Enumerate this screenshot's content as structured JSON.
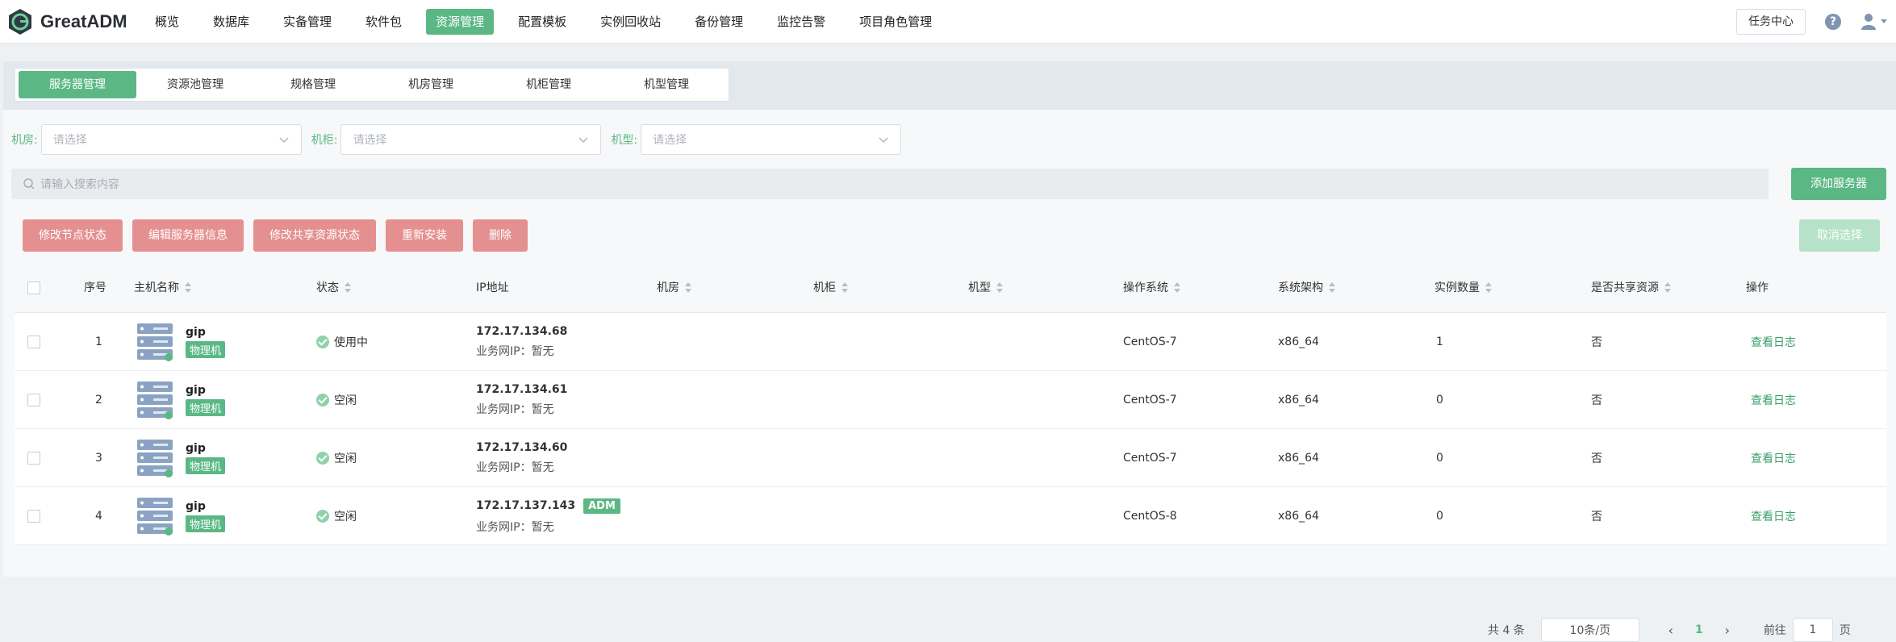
{
  "brand": {
    "name": "GreatADM"
  },
  "nav": {
    "items": [
      {
        "label": "概览"
      },
      {
        "label": "数据库"
      },
      {
        "label": "实备管理"
      },
      {
        "label": "软件包"
      },
      {
        "label": "资源管理",
        "active": true
      },
      {
        "label": "配置模板"
      },
      {
        "label": "实例回收站"
      },
      {
        "label": "备份管理"
      },
      {
        "label": "监控告警"
      },
      {
        "label": "项目角色管理"
      }
    ]
  },
  "topright": {
    "task_center": "任务中心",
    "help_icon": "question-circle-icon",
    "user_icon": "user-icon"
  },
  "tabs": [
    {
      "label": "服务器管理",
      "active": true
    },
    {
      "label": "资源池管理"
    },
    {
      "label": "规格管理"
    },
    {
      "label": "机房管理"
    },
    {
      "label": "机柜管理"
    },
    {
      "label": "机型管理"
    }
  ],
  "filters": {
    "room": {
      "label": "机房:",
      "placeholder": "请选择"
    },
    "cabinet": {
      "label": "机柜:",
      "placeholder": "请选择"
    },
    "model": {
      "label": "机型:",
      "placeholder": "请选择"
    }
  },
  "search": {
    "placeholder": "请输入搜索内容"
  },
  "buttons": {
    "add_server": "添加服务器",
    "cancel_select": "取消选择",
    "modify_node_status": "修改节点状态",
    "edit_server_info": "编辑服务器信息",
    "modify_shared_status": "修改共享资源状态",
    "reinstall": "重新安装",
    "delete": "删除"
  },
  "table": {
    "headers": {
      "index": "序号",
      "host": "主机名称",
      "status": "状态",
      "ip": "IP地址",
      "room": "机房",
      "cabinet": "机柜",
      "model": "机型",
      "os": "操作系统",
      "arch": "系统架构",
      "instances": "实例数量",
      "shared": "是否共享资源",
      "ops": "操作"
    },
    "rows": [
      {
        "index": "1",
        "host": "gip",
        "tag": "物理机",
        "status": "使用中",
        "ip": "172.17.134.68",
        "ip_sub": "业务网IP：暂无",
        "adm": "",
        "os": "CentOS-7",
        "arch": "x86_64",
        "instances": "1",
        "shared": "否",
        "op": "查看日志"
      },
      {
        "index": "2",
        "host": "gip",
        "tag": "物理机",
        "status": "空闲",
        "ip": "172.17.134.61",
        "ip_sub": "业务网IP：暂无",
        "adm": "",
        "os": "CentOS-7",
        "arch": "x86_64",
        "instances": "0",
        "shared": "否",
        "op": "查看日志"
      },
      {
        "index": "3",
        "host": "gip",
        "tag": "物理机",
        "status": "空闲",
        "ip": "172.17.134.60",
        "ip_sub": "业务网IP：暂无",
        "adm": "",
        "os": "CentOS-7",
        "arch": "x86_64",
        "instances": "0",
        "shared": "否",
        "op": "查看日志"
      },
      {
        "index": "4",
        "host": "gip",
        "tag": "物理机",
        "status": "空闲",
        "ip": "172.17.137.143",
        "ip_sub": "业务网IP：暂无",
        "adm": "ADM",
        "os": "CentOS-8",
        "arch": "x86_64",
        "instances": "0",
        "shared": "否",
        "op": "查看日志"
      }
    ]
  },
  "pagination": {
    "total": "共 4 条",
    "page_size": "10条/页",
    "current": "1",
    "goto_label": "前往",
    "goto_value": "1",
    "page_unit": "页"
  },
  "colors": {
    "accent": "#5bb885",
    "danger": "#e59090"
  }
}
